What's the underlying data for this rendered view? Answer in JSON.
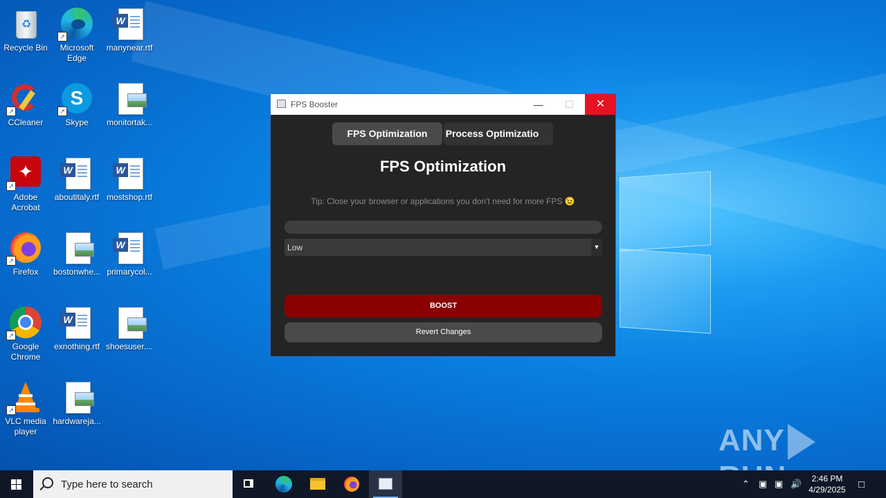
{
  "desktop": {
    "icons": [
      {
        "label": "Recycle Bin"
      },
      {
        "label": "Microsoft Edge"
      },
      {
        "label": "manynear.rtf"
      },
      {
        "label": "CCleaner"
      },
      {
        "label": "Skype"
      },
      {
        "label": "monitortak..."
      },
      {
        "label": "Adobe Acrobat"
      },
      {
        "label": "aboutitaly.rtf"
      },
      {
        "label": "mostshop.rtf"
      },
      {
        "label": "Firefox"
      },
      {
        "label": "bostonwhe..."
      },
      {
        "label": "primarycol..."
      },
      {
        "label": "Google Chrome"
      },
      {
        "label": "exnothing.rtf"
      },
      {
        "label": "shoesuser...."
      },
      {
        "label": "VLC media player"
      },
      {
        "label": "hardwareja..."
      }
    ]
  },
  "app": {
    "window_title": "FPS Booster",
    "tabs": [
      {
        "label": "FPS Optimization"
      },
      {
        "label": "Process Optimizatio"
      }
    ],
    "heading": "FPS Optimization",
    "tip": "Tip: Close your browser or applications you don't need for more FPS 😉",
    "progress": 0,
    "dropdown_value": "Low",
    "boost_label": "BOOST",
    "revert_label": "Revert Changes"
  },
  "watermark": {
    "left": "ANY",
    "right": "RUN"
  },
  "taskbar": {
    "search_placeholder": "Type here to search",
    "time": "2:46 PM",
    "date": "4/29/2025"
  }
}
